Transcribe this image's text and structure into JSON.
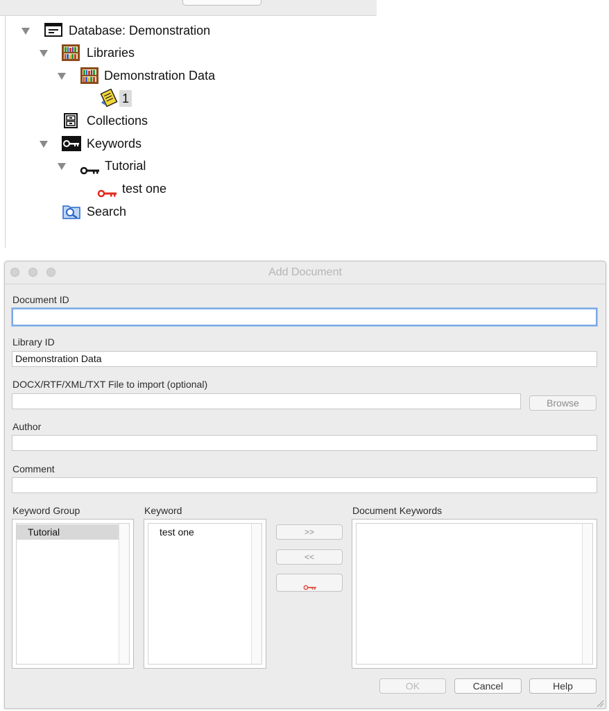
{
  "tree": {
    "database_label": "Database: Demonstration",
    "libraries_label": "Libraries",
    "library_item_label": "Demonstration Data",
    "document_item_label": "1",
    "collections_label": "Collections",
    "keywords_label": "Keywords",
    "keyword_group_label": "Tutorial",
    "keyword_item_label": "test one",
    "search_label": "Search",
    "icons": {
      "database": "database-icon",
      "libraries": "bookshelf-icon",
      "library": "bookshelf-icon",
      "document": "document-icon",
      "collections": "cabinet-icon",
      "keywords": "keys-icon",
      "keyword_group": "key-icon",
      "keyword": "red-key-icon",
      "search": "search-folder-icon"
    }
  },
  "dialog": {
    "title": "Add Document",
    "document_id_label": "Document ID",
    "document_id_value": "",
    "library_id_label": "Library ID",
    "library_id_value": "Demonstration Data",
    "file_label": "DOCX/RTF/XML/TXT File to import  (optional)",
    "file_value": "",
    "browse_label": "Browse",
    "author_label": "Author",
    "author_value": "",
    "comment_label": "Comment",
    "comment_value": "",
    "keyword_group_header": "Keyword Group",
    "keyword_groups": [
      "Tutorial"
    ],
    "keyword_header": "Keyword",
    "keywords": [
      "test one"
    ],
    "document_keywords_header": "Document Keywords",
    "document_keywords": [],
    "add_button": ">>",
    "remove_button": "<<",
    "ok_label": "OK",
    "cancel_label": "Cancel",
    "help_label": "Help"
  },
  "colors": {
    "key_red": "#e32a1c",
    "focus_ring": "#7aa9e6",
    "dialog_bg": "#ececec"
  }
}
